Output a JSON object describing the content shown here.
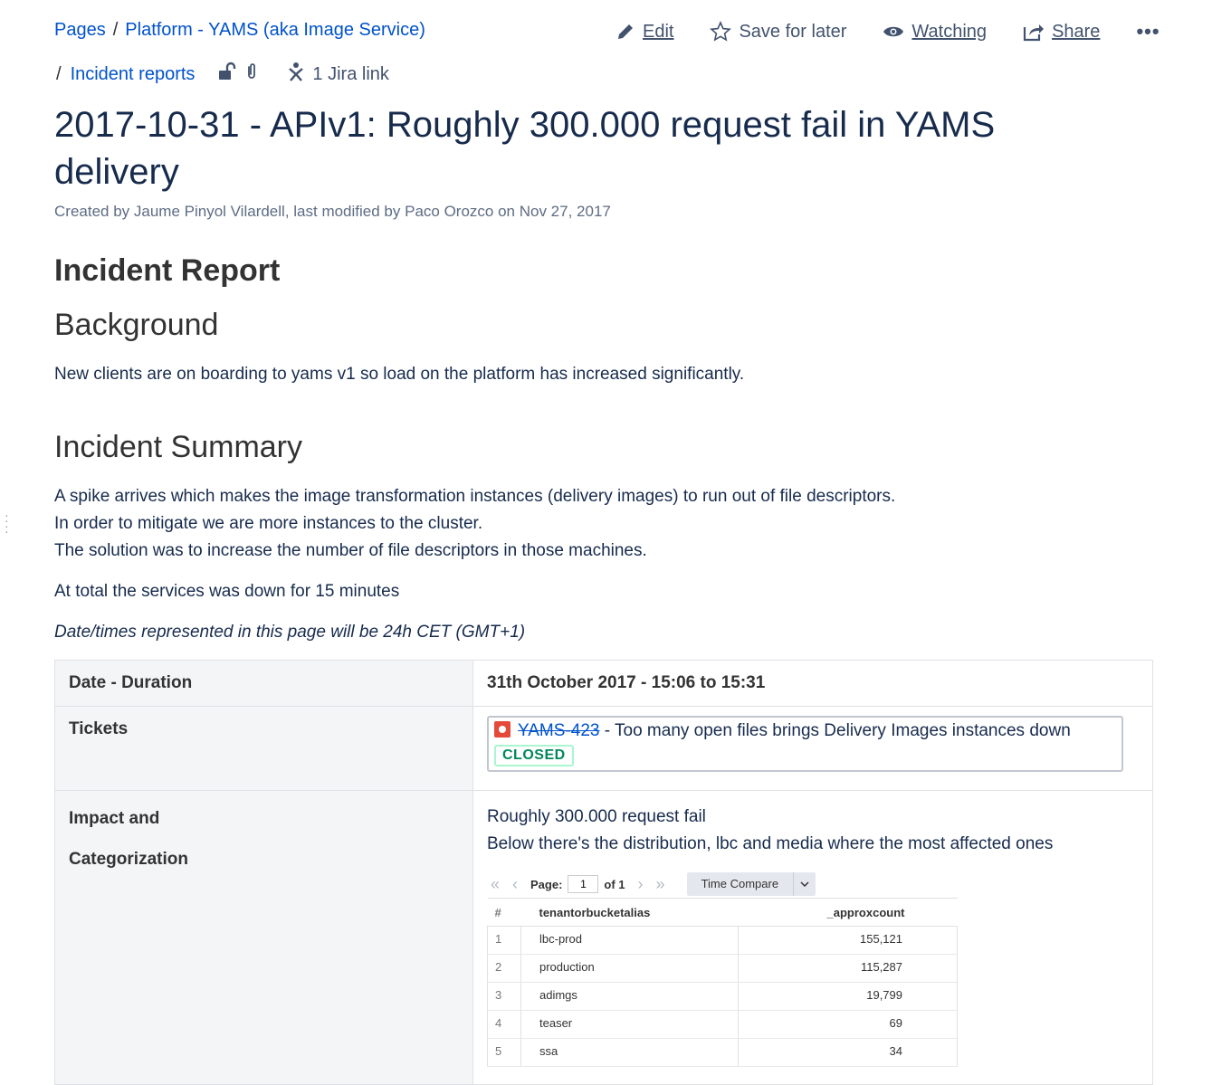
{
  "breadcrumb": {
    "pages": "Pages",
    "sep": "/",
    "space": "Platform - YAMS (aka Image Service)",
    "parent": "Incident reports",
    "jira_link": "1 Jira link"
  },
  "actions": {
    "edit": "Edit",
    "save": "Save for later",
    "watching": "Watching",
    "share": "Share",
    "more": "•••"
  },
  "page": {
    "title": "2017-10-31 - APIv1: Roughly 300.000 request fail in YAMS delivery",
    "byline": "Created by Jaume Pinyol Vilardell, last modified by Paco Orozco on Nov 27, 2017"
  },
  "content": {
    "h_report": "Incident Report",
    "h_background": "Background",
    "background_text": "New clients are on boarding to yams v1 so load on the platform has increased significantly.",
    "h_summary": "Incident Summary",
    "summary_lines": [
      "A spike arrives which makes the image transformation instances (delivery images) to run out of file descriptors.",
      "In order to mitigate we are more instances to the cluster.",
      "The solution was to increase the number of file descriptors in those machines."
    ],
    "total_down": "At total the services was down for 15 minutes",
    "tz_note": "Date/times represented in this page will be 24h CET (GMT+1)"
  },
  "info_table": {
    "date_label": "Date - Duration",
    "date_value": "31th October 2017 - 15:06 to 15:31",
    "tickets_label": "Tickets",
    "ticket_key": "YAMS-423",
    "ticket_summary": " - Too many open files brings Delivery Images instances down",
    "ticket_status": "CLOSED",
    "impact_label_1": "Impact and",
    "impact_label_2": "Categorization",
    "impact_line_1": "Roughly 300.000 request fail",
    "impact_line_2": "Below there's the distribution, lbc and media where the most affected ones"
  },
  "report": {
    "page_label": "Page:",
    "page_value": "1",
    "of_label": "of 1",
    "time_compare": "Time Compare",
    "columns": [
      "#",
      "tenantorbucketalias",
      "_approxcount"
    ],
    "rows": [
      [
        "1",
        "lbc-prod",
        "155,121"
      ],
      [
        "2",
        "production",
        "115,287"
      ],
      [
        "3",
        "adimgs",
        "19,799"
      ],
      [
        "4",
        "teaser",
        "69"
      ],
      [
        "5",
        "ssa",
        "34"
      ]
    ]
  }
}
